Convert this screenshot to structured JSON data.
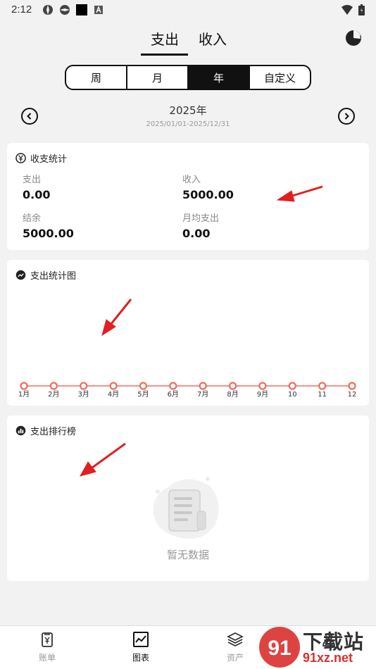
{
  "status_bar": {
    "time": "2:12"
  },
  "top_tabs": [
    {
      "label": "支出",
      "active": true
    },
    {
      "label": "收入",
      "active": false
    }
  ],
  "period_tabs": [
    {
      "label": "周",
      "active": false
    },
    {
      "label": "月",
      "active": false
    },
    {
      "label": "年",
      "active": true
    },
    {
      "label": "自定义",
      "active": false
    }
  ],
  "period": {
    "title": "2025年",
    "range": "2025/01/01-2025/12/31"
  },
  "stats_card": {
    "title": "收支统计",
    "expense_label": "支出",
    "expense_value": "0.00",
    "income_label": "收入",
    "income_value": "5000.00",
    "balance_label": "结余",
    "balance_value": "5000.00",
    "monthly_avg_label": "月均支出",
    "monthly_avg_value": "0.00"
  },
  "chart_card": {
    "title": "支出统计图"
  },
  "chart_data": {
    "type": "line",
    "categories": [
      "1月",
      "2月",
      "3月",
      "4月",
      "5月",
      "6月",
      "7月",
      "8月",
      "9月",
      "10",
      "11",
      "12"
    ],
    "series": [
      {
        "values": [
          0,
          0,
          0,
          0,
          0,
          0,
          0,
          0,
          0,
          0,
          0,
          0
        ]
      }
    ],
    "color": "#f26b5b"
  },
  "ranking_card": {
    "title": "支出排行榜",
    "empty_text": "暂无数据"
  },
  "bottom_nav": [
    {
      "label": "账单",
      "icon": "receipt-icon",
      "active": false
    },
    {
      "label": "图表",
      "icon": "chart-icon",
      "active": true
    },
    {
      "label": "资产",
      "icon": "layers-icon",
      "active": false
    },
    {
      "label": "",
      "icon": "person-icon",
      "active": false
    }
  ],
  "watermark": {
    "text": "下载站",
    "sub": "91xz.net"
  }
}
